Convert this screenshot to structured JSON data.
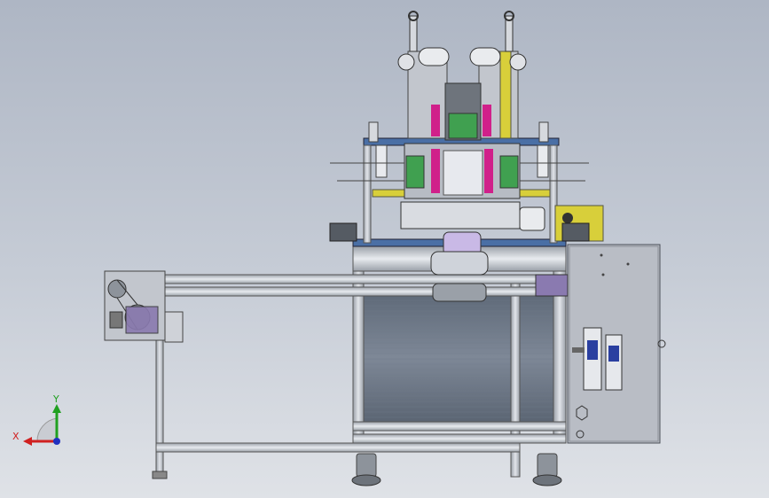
{
  "viewport": {
    "background_top": "#aeb6c4",
    "background_bottom": "#dfe2e7",
    "model_description_visible": false
  },
  "triad": {
    "x_label": "X",
    "y_label": "Y",
    "x_color": "#d02020",
    "y_color": "#20a020",
    "z_color": "#2030c0"
  },
  "colors": {
    "frame_aluminum": "#c8ccd2",
    "panel_glass": "#6a7584",
    "plate_blue": "#4a6fa5",
    "accent_yellow": "#d8cf3a",
    "accent_magenta": "#d0208a",
    "accent_green": "#40a050",
    "cabinet": "#b8bcc4",
    "motor_purple": "#8a7ab0"
  }
}
